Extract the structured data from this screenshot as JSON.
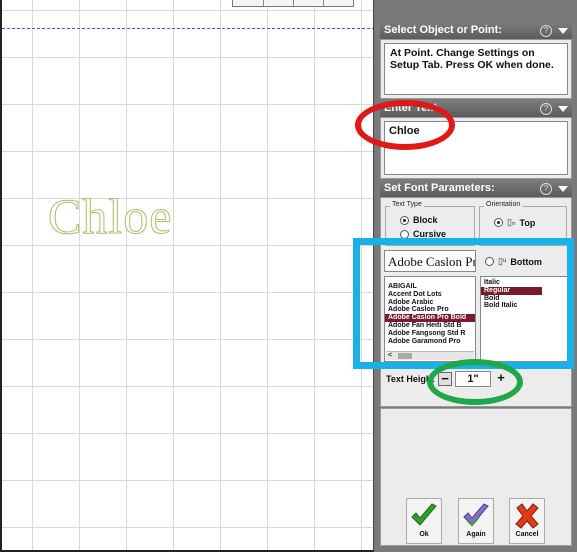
{
  "canvas": {
    "text": "Chloe"
  },
  "select_section": {
    "title": "Select Object or Point:",
    "instruction": "At Point. Change Settings on Setup Tab. Press OK when done."
  },
  "enter_text_section": {
    "title": "Enter Text",
    "value": "Chloe"
  },
  "font_section": {
    "title": "Set Font Parameters:",
    "text_type": {
      "label": "Text Type",
      "options": [
        "Block",
        "Cursive"
      ],
      "selected": "Block"
    },
    "orientation": {
      "label": "Orientation",
      "options": [
        "Top",
        "Bottom"
      ],
      "selected": "Top"
    },
    "font_preview": "Adobe Caslon Pro B",
    "fonts": [
      "ABIGAIL",
      "Accent Dot Lots",
      "Adobe Arabic",
      "Adobe Caslon Pro",
      "Adobe Caslon Pro Bold",
      "Adobe Fan Heiti Std B",
      "Adobe Fangsong Std R",
      "Adobe Garamond Pro"
    ],
    "selected_font": "Adobe Caslon Pro Bold",
    "styles": [
      "Italic",
      "Regular",
      "Bold",
      "Bold Italic"
    ],
    "selected_style": "Regular",
    "text_height_label": "Text Height",
    "text_height_value": "1\""
  },
  "buttons": {
    "ok": "Ok",
    "again": "Again",
    "cancel": "Cancel"
  },
  "colors": {
    "red_circle": "#e01818",
    "blue_box": "#1ab0e8",
    "green_circle": "#1ea84a",
    "selection": "#7b1a2c"
  }
}
